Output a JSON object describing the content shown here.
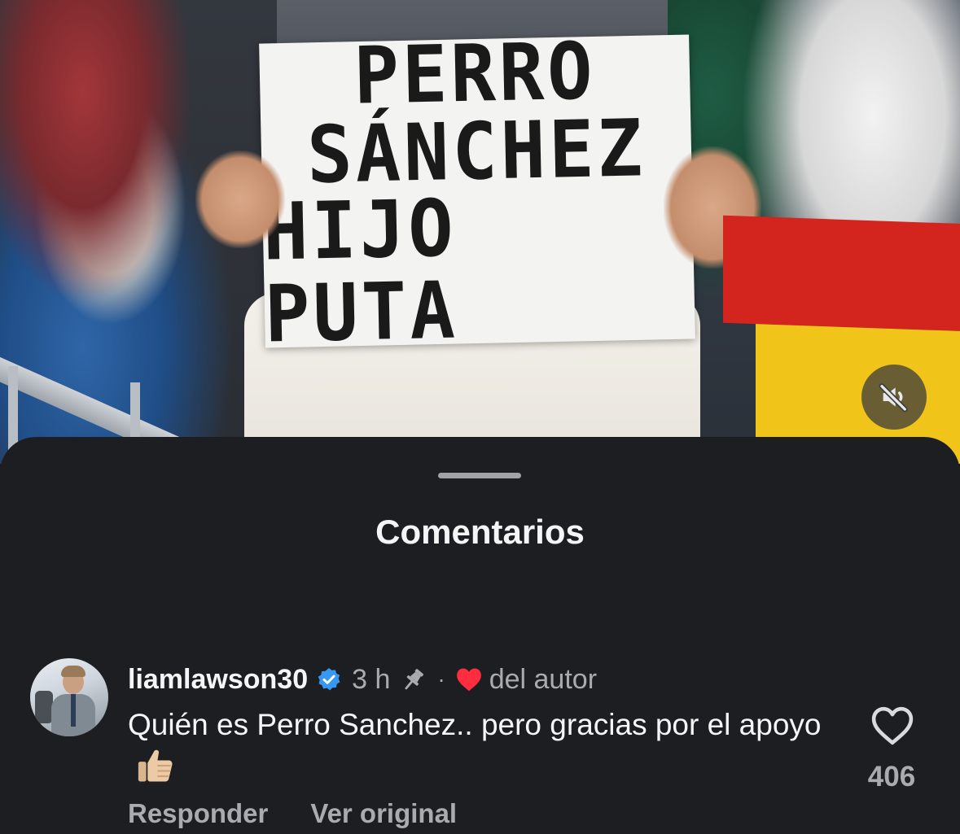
{
  "video": {
    "sign_lines": [
      "PERRO",
      "SÁNCHEZ",
      "HIJO PUTA"
    ],
    "mute_icon": "speaker-muted-icon"
  },
  "sheet": {
    "title": "Comentarios"
  },
  "comment": {
    "username": "liamlawson30",
    "verified_icon": "verified-badge-icon",
    "time": "3 h",
    "pin_icon": "pin-icon",
    "separator": "·",
    "author_like_icon": "red-heart-icon",
    "author_label": "del autor",
    "text": "Quién es Perro Sanchez.. pero gracias por el apoyo",
    "emoji_icon": "thumbs-up-emoji",
    "like_icon": "heart-outline-icon",
    "like_count": "406",
    "reply_label": "Responder",
    "translate_label": "Ver original"
  },
  "colors": {
    "sheet_bg": "#1c1e22",
    "primary_text": "#f5f5f5",
    "secondary_text": "#a8abb0",
    "verified_blue": "#3897f0",
    "heart_red": "#ff2d3d"
  }
}
